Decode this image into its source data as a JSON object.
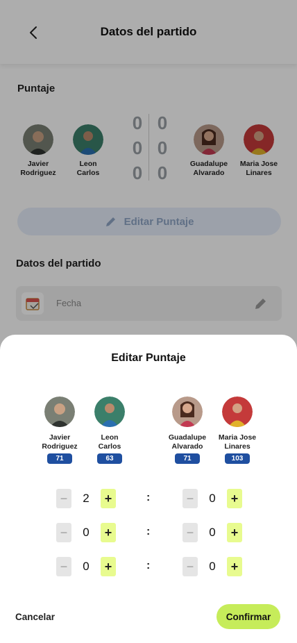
{
  "header": {
    "title": "Datos del partido"
  },
  "score_section": {
    "title": "Puntaje"
  },
  "team_a": [
    {
      "first": "Javier",
      "last": "Rodriguez",
      "rating": "71"
    },
    {
      "first": "Leon",
      "last": "Carlos",
      "rating": "63"
    }
  ],
  "team_b": [
    {
      "first": "Guadalupe",
      "last": "Alvarado",
      "rating": "71"
    },
    {
      "first": "Maria Jose",
      "last": "Linares",
      "rating": "103"
    }
  ],
  "background_scores": [
    [
      "0",
      "0"
    ],
    [
      "0",
      "0"
    ],
    [
      "0",
      "0"
    ]
  ],
  "edit_score_button": "Editar Puntaje",
  "match_section": {
    "title": "Datos del partido",
    "date_placeholder": "Fecha"
  },
  "modal": {
    "title": "Editar Puntaje",
    "sets": [
      {
        "a": "2",
        "b": "0"
      },
      {
        "a": "0",
        "b": "0"
      },
      {
        "a": "0",
        "b": "0"
      }
    ],
    "separator": ":",
    "minus": "−",
    "plus": "+",
    "cancel": "Cancelar",
    "confirm": "Confirmar"
  },
  "colors": {
    "accent_green": "#c6ec5a",
    "plus_green": "#e8fb8f",
    "rating_blue": "#1f4fa0",
    "overlay": "rgba(0,0,0,0.32)"
  }
}
